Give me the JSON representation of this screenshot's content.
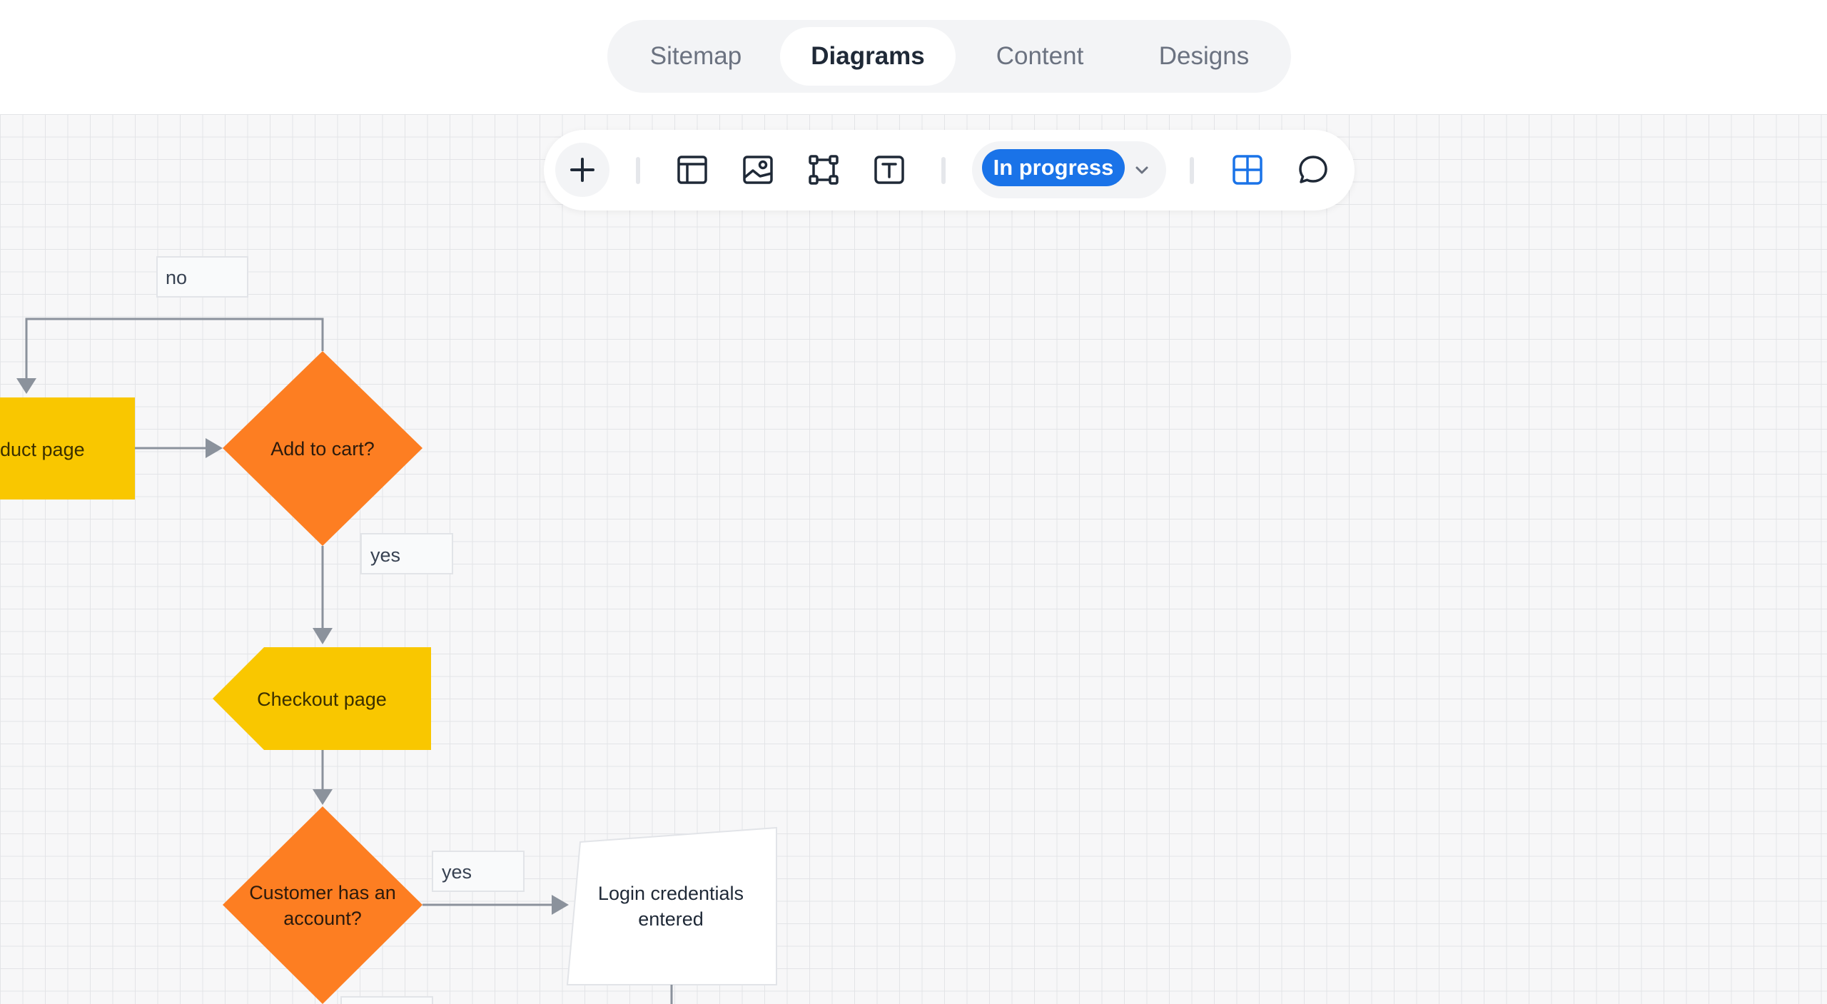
{
  "nav": {
    "tabs": [
      {
        "label": "Sitemap",
        "active": false
      },
      {
        "label": "Diagrams",
        "active": true
      },
      {
        "label": "Content",
        "active": false
      },
      {
        "label": "Designs",
        "active": false
      }
    ]
  },
  "toolbar": {
    "tools": [
      "plus-icon",
      "layout-icon",
      "image-icon",
      "frame-icon",
      "text-icon",
      "grid-icon",
      "comment-icon"
    ],
    "status": {
      "label": "In progress",
      "color": "#1a73e8"
    },
    "accent": "#1a73e8"
  },
  "flowchart": {
    "colors": {
      "process": "#f9c700",
      "decision": "#fd7e22",
      "connector": "#8b929c"
    },
    "nodes": {
      "product_page": "duct page",
      "add_to_cart": "Add to cart?",
      "checkout_page": "Checkout page",
      "has_account_line1": "Customer has an",
      "has_account_line2": "account?",
      "login_line1": "Login credentials",
      "login_line2": "entered"
    },
    "edge_labels": {
      "no": "no",
      "yes_checkout": "yes",
      "yes_login": "yes"
    }
  }
}
